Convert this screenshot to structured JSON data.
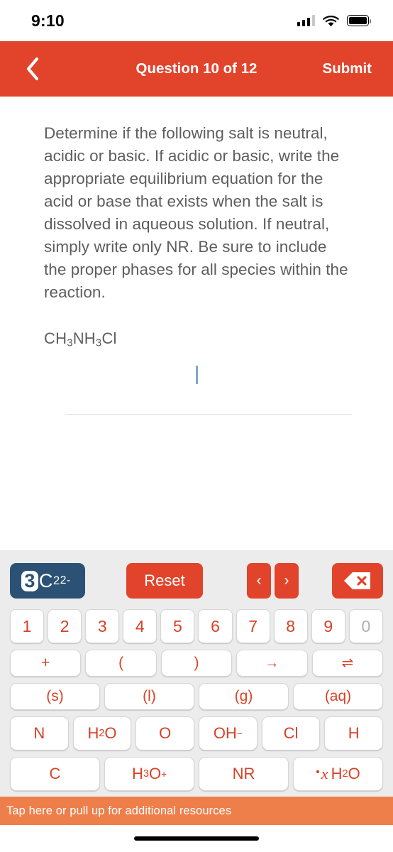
{
  "status_bar": {
    "time": "9:10",
    "icons": [
      "cellular-signal-icon",
      "wifi-icon",
      "battery-icon"
    ]
  },
  "nav_bar": {
    "back_icon": "chevron-left-icon",
    "title": "Question 10 of 12",
    "submit_label": "Submit",
    "background_color": "#E1442B"
  },
  "question": {
    "prompt": "Determine if the following salt is neutral, acidic or basic. If acidic or basic, write the appropriate equilibrium equation for the acid or base that exists when the salt is dissolved in aqueous solution. If neutral, simply write only NR. Be sure to include the proper phases for all species within the reaction.",
    "formula_parts": [
      {
        "text": "CH",
        "sub": "3"
      },
      {
        "text": "NH",
        "sub": "3"
      },
      {
        "text": "Cl",
        "sub": ""
      }
    ],
    "answer_value": ""
  },
  "keyboard": {
    "coefficient_chip": {
      "selected": "3",
      "element": "C",
      "subscript": "2",
      "superscript": "2-",
      "background_color": "#2B5275"
    },
    "reset_label": "Reset",
    "prev_label": "‹",
    "next_label": "›",
    "delete_icon": "backspace-delete-icon",
    "number_row": [
      {
        "label": "1",
        "disabled": false
      },
      {
        "label": "2",
        "disabled": false
      },
      {
        "label": "3",
        "disabled": false
      },
      {
        "label": "4",
        "disabled": false
      },
      {
        "label": "5",
        "disabled": false
      },
      {
        "label": "6",
        "disabled": false
      },
      {
        "label": "7",
        "disabled": false
      },
      {
        "label": "8",
        "disabled": false
      },
      {
        "label": "9",
        "disabled": false
      },
      {
        "label": "0",
        "disabled": true
      }
    ],
    "operator_row": [
      "+",
      "(",
      ")",
      "→",
      "⇌"
    ],
    "phase_row": [
      "(s)",
      "(l)",
      "(g)",
      "(aq)"
    ],
    "species_row_1": [
      {
        "text": "N"
      },
      {
        "text": "H",
        "sub": "2",
        "after": "O"
      },
      {
        "text": "O"
      },
      {
        "text": "OH",
        "sup": "−"
      },
      {
        "text": "Cl"
      },
      {
        "text": "H"
      }
    ],
    "species_row_2": [
      {
        "text": "C"
      },
      {
        "text": "H",
        "sub": "3",
        "after": "O",
        "sup": "+"
      },
      {
        "text": "NR"
      },
      {
        "text": "• x H",
        "sub": "2",
        "after": "O",
        "special": "hydrate"
      }
    ],
    "key_text_color": "#D94126",
    "disabled_key_color": "#B0B0B0",
    "background_color": "#ECECEC"
  },
  "resource_bar": {
    "label": "Tap here or pull up for additional resources",
    "background_color": "#EE7F4B"
  },
  "home_indicator": "home-indicator"
}
